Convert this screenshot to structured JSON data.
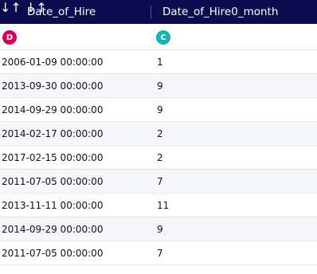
{
  "columns": [
    {
      "header": "Date_of_Hire",
      "sort_icon": "↓↑",
      "type_badge": "D",
      "badge_color": "#d6005f"
    },
    {
      "header": "Date_of_Hire0_month",
      "sort_icon": "↓↑",
      "type_badge": "C",
      "badge_color": "#16b3b3"
    }
  ],
  "rows": [
    [
      "2006-01-09 00:00:00",
      "1"
    ],
    [
      "2013-09-30 00:00:00",
      "9"
    ],
    [
      "2014-09-29 00:00:00",
      "9"
    ],
    [
      "2014-02-17 00:00:00",
      "2"
    ],
    [
      "2017-02-15 00:00:00",
      "2"
    ],
    [
      "2011-07-05 00:00:00",
      "7"
    ],
    [
      "2013-11-11 00:00:00",
      "11"
    ],
    [
      "2014-09-29 00:00:00",
      "9"
    ],
    [
      "2011-07-05 00:00:00",
      "7"
    ]
  ]
}
